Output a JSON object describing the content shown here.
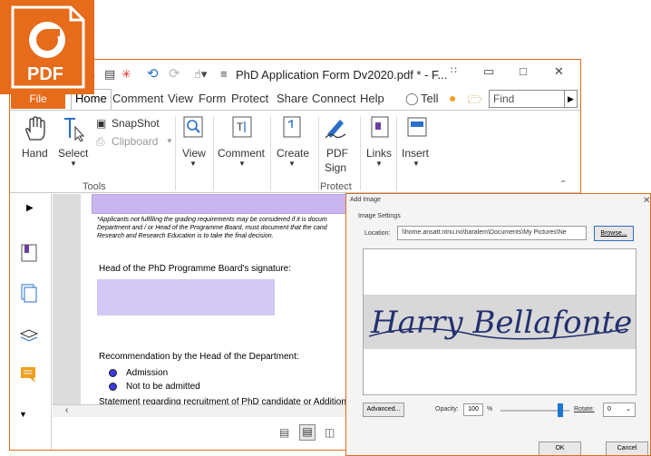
{
  "window": {
    "title": "PhD Application Form Dv2020.pdf * - F...",
    "accent": "#e66b1a"
  },
  "logo": {
    "label": "PDF"
  },
  "menu": {
    "file": "File",
    "tabs": [
      "Home",
      "Comment",
      "View",
      "Form",
      "Protect",
      "Share",
      "Connect",
      "Help"
    ],
    "tell": "Tell",
    "find_placeholder": "Find"
  },
  "ribbon": {
    "hand": "Hand",
    "select": "Select",
    "snapshot": "SnapShot",
    "clipboard": "Clipboard",
    "view": "View",
    "comment": "Comment",
    "create": "Create",
    "pdf": "PDF",
    "sign": "Sign",
    "links": "Links",
    "insert": "Insert",
    "group_tools": "Tools",
    "group_protect": "Protect"
  },
  "document": {
    "note_line1": "*Applicants not fulfilling the grading requirements may be considered if it is docum",
    "note_line2": "Department and / or Head of the Programme Board, must document that the cand",
    "note_line3": "Research and Research Education is to take the final decision.",
    "signature_heading": "Head of the PhD Programme Board's signature:",
    "recommendation": "Recommendation by the Head of the Department:",
    "option1": "Admission",
    "option2": "Not to be admitted",
    "statement": "Statement regarding recruitment of PhD candidate or Addition"
  },
  "dialog": {
    "title": "Add Image",
    "settings": "Image Settings",
    "location_label": "Location:",
    "location_value": "\\\\home.ansatt.ntnu.no\\haralem\\Documents\\My Pictures\\Ne",
    "browse": "Browse...",
    "signature_text": "Harry Bellafonte",
    "advanced": "Advanced...",
    "opacity_label": "Opacity:",
    "opacity_value": "100",
    "percent": "%",
    "opacity_level": 100,
    "rotate_label": "Rotate:",
    "rotate_value": "0",
    "ok": "OK",
    "cancel": "Cancel"
  }
}
